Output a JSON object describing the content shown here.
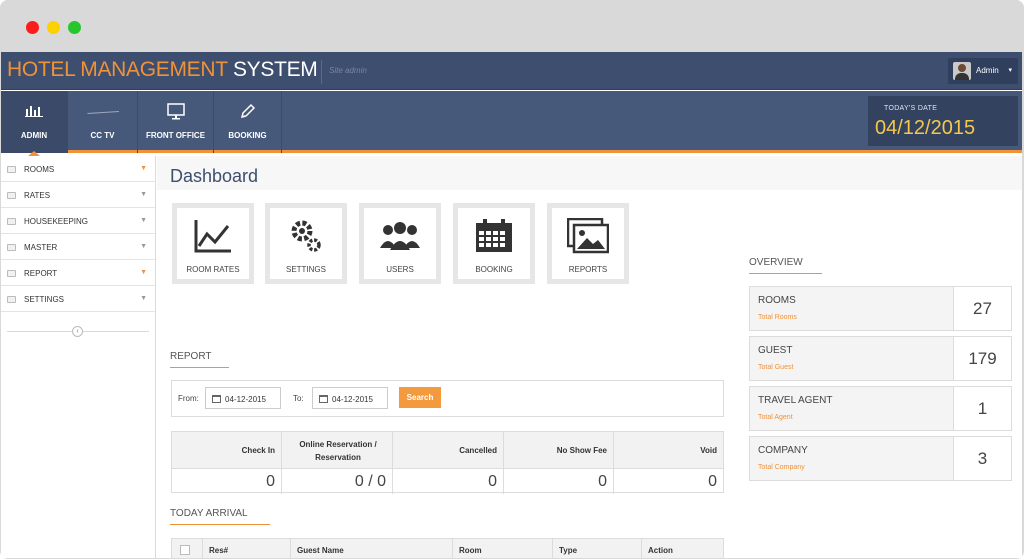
{
  "brand": {
    "part1": "HOTEL MANAGEMENT",
    "part2": "SYSTEM",
    "subtitle": "Site admin"
  },
  "user": {
    "name": "Admin"
  },
  "nav": {
    "items": [
      {
        "label": "ADMIN",
        "icon": "bar-chart-icon",
        "active": true
      },
      {
        "label": "CC TV",
        "icon": "cctv-icon",
        "active": false
      },
      {
        "label": "FRONT OFFICE",
        "icon": "monitor-icon",
        "active": false
      },
      {
        "label": "BOOKING",
        "icon": "pencil-icon",
        "active": false
      }
    ],
    "today_label": "TODAY'S DATE",
    "today_value": "04/12/2015"
  },
  "sidebar": {
    "items": [
      {
        "label": "ROOMS"
      },
      {
        "label": "RATES"
      },
      {
        "label": "HOUSEKEEPING"
      },
      {
        "label": "MASTER"
      },
      {
        "label": "REPORT"
      },
      {
        "label": "SETTINGS"
      }
    ]
  },
  "main": {
    "title": "Dashboard",
    "tiles": [
      {
        "label": "ROOM RATES",
        "icon": "line-chart-icon"
      },
      {
        "label": "SETTINGS",
        "icon": "gears-icon"
      },
      {
        "label": "USERS",
        "icon": "users-icon"
      },
      {
        "label": "BOOKING",
        "icon": "calendar-icon"
      },
      {
        "label": "REPORTS",
        "icon": "images-icon"
      }
    ],
    "report": {
      "title": "REPORT",
      "from_label": "From:",
      "from_value": "04-12-2015",
      "to_label": "To:",
      "to_value": "04-12-2015",
      "search_label": "Search",
      "columns": [
        {
          "header_line1": "Check In",
          "header_line2": "",
          "value": "0"
        },
        {
          "header_line1": "Online Reservation /",
          "header_line2": "Reservation",
          "value": "0 / 0"
        },
        {
          "header_line1": "Cancelled",
          "header_line2": "",
          "value": "0"
        },
        {
          "header_line1": "No Show Fee",
          "header_line2": "",
          "value": "0"
        },
        {
          "header_line1": "Void",
          "header_line2": "",
          "value": "0"
        }
      ]
    },
    "arrival": {
      "title": "TODAY ARRIVAL",
      "headers": [
        "Res#",
        "Guest Name",
        "Room",
        "Type",
        "Action"
      ]
    }
  },
  "overview": {
    "title": "OVERVIEW",
    "cards": [
      {
        "title": "ROOMS",
        "subtitle": "Total Rooms",
        "value": "27"
      },
      {
        "title": "GUEST",
        "subtitle": "Total Guest",
        "value": "179"
      },
      {
        "title": "TRAVEL AGENT",
        "subtitle": "Total Agent",
        "value": "1"
      },
      {
        "title": "COMPANY",
        "subtitle": "Total Company",
        "value": "3"
      }
    ]
  },
  "colors": {
    "accent": "#f0923a",
    "header": "#3d4e6e",
    "date": "#f5c84b"
  }
}
